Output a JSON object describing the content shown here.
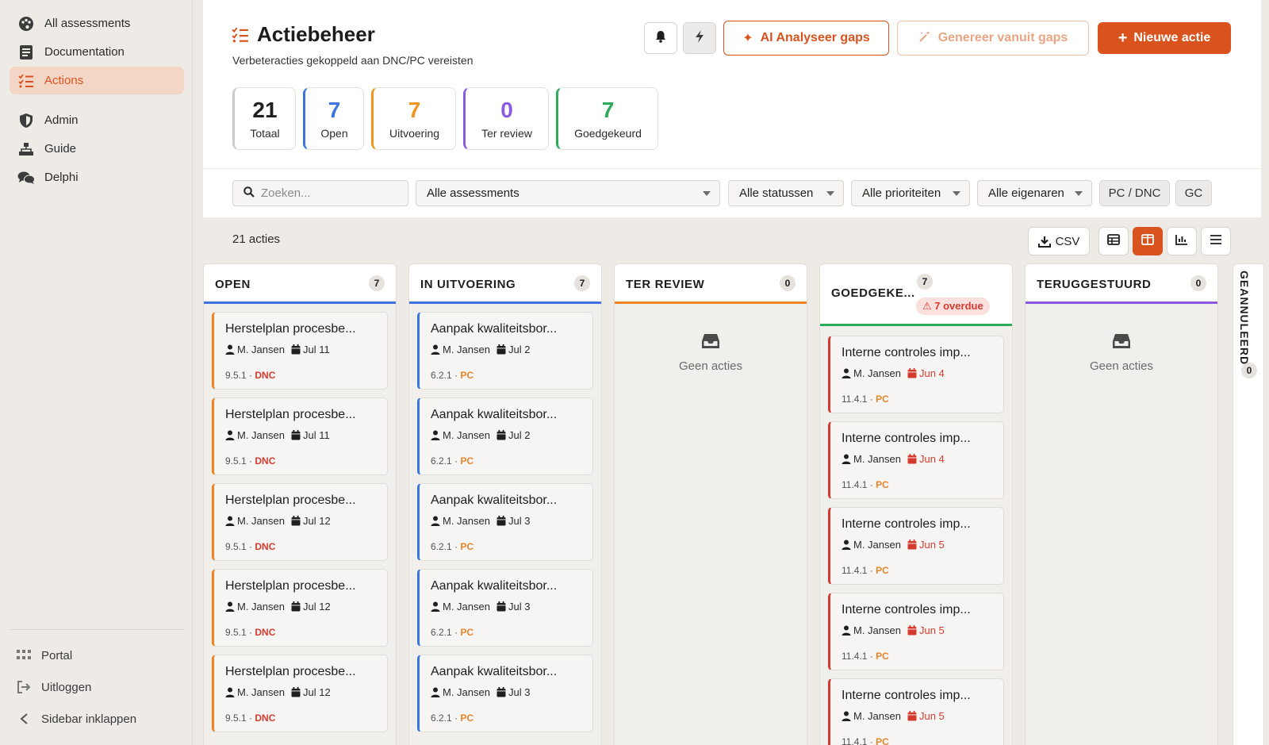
{
  "sidebar": {
    "items": [
      {
        "label": "All assessments",
        "icon": "palette-icon"
      },
      {
        "label": "Documentation",
        "icon": "document-icon"
      },
      {
        "label": "Actions",
        "icon": "list-check-icon"
      },
      {
        "label": "Admin",
        "icon": "shield-icon"
      },
      {
        "label": "Guide",
        "icon": "sitemap-icon"
      },
      {
        "label": "Delphi",
        "icon": "comments-icon"
      }
    ],
    "footer": {
      "portal": "Portal",
      "logout": "Uitloggen",
      "collapse": "Sidebar inklappen"
    }
  },
  "header": {
    "title": "Actiebeheer",
    "subtitle": "Verbeteracties gekoppeld aan DNC/PC vereisten",
    "ai_button": "AI Analyseer gaps",
    "generate_button": "Genereer vanuit gaps",
    "new_button": "Nieuwe actie"
  },
  "stats": [
    {
      "value": "21",
      "label": "Totaal",
      "color": "#1f1f1f"
    },
    {
      "value": "7",
      "label": "Open",
      "color": "#3b73e0"
    },
    {
      "value": "7",
      "label": "Uitvoering",
      "color": "#f0941e"
    },
    {
      "value": "0",
      "label": "Ter review",
      "color": "#8a5ae0"
    },
    {
      "value": "7",
      "label": "Goedgekeurd",
      "color": "#2eaa5a"
    }
  ],
  "filters": {
    "search_placeholder": "Zoeken...",
    "assessments": "Alle assessments",
    "statuses": "Alle statussen",
    "priorities": "Alle prioriteiten",
    "owners": "Alle eigenaren",
    "chip_pc_dnc": "PC / DNC",
    "chip_gc": "GC"
  },
  "toolbar": {
    "count": "21 acties",
    "csv": "CSV"
  },
  "columns": {
    "open": {
      "title": "OPEN",
      "count": "7",
      "color": "#3b73e0",
      "cards": [
        {
          "title": "Herstelplan procesbe...",
          "owner": "M. Jansen",
          "date": "Jul 11",
          "ref": "9.5.1 ·",
          "tag": "DNC"
        },
        {
          "title": "Herstelplan procesbe...",
          "owner": "M. Jansen",
          "date": "Jul 11",
          "ref": "9.5.1 ·",
          "tag": "DNC"
        },
        {
          "title": "Herstelplan procesbe...",
          "owner": "M. Jansen",
          "date": "Jul 12",
          "ref": "9.5.1 ·",
          "tag": "DNC"
        },
        {
          "title": "Herstelplan procesbe...",
          "owner": "M. Jansen",
          "date": "Jul 12",
          "ref": "9.5.1 ·",
          "tag": "DNC"
        },
        {
          "title": "Herstelplan procesbe...",
          "owner": "M. Jansen",
          "date": "Jul 12",
          "ref": "9.5.1 ·",
          "tag": "DNC"
        }
      ]
    },
    "progress": {
      "title": "IN UITVOERING",
      "count": "7",
      "color": "#3b73e0",
      "cards": [
        {
          "title": "Aanpak kwaliteitsbor...",
          "owner": "M. Jansen",
          "date": "Jul 2",
          "ref": "6.2.1 ·",
          "tag": "PC"
        },
        {
          "title": "Aanpak kwaliteitsbor...",
          "owner": "M. Jansen",
          "date": "Jul 2",
          "ref": "6.2.1 ·",
          "tag": "PC"
        },
        {
          "title": "Aanpak kwaliteitsbor...",
          "owner": "M. Jansen",
          "date": "Jul 3",
          "ref": "6.2.1 ·",
          "tag": "PC"
        },
        {
          "title": "Aanpak kwaliteitsbor...",
          "owner": "M. Jansen",
          "date": "Jul 3",
          "ref": "6.2.1 ·",
          "tag": "PC"
        },
        {
          "title": "Aanpak kwaliteitsbor...",
          "owner": "M. Jansen",
          "date": "Jul 3",
          "ref": "6.2.1 ·",
          "tag": "PC"
        }
      ]
    },
    "review": {
      "title": "TER REVIEW",
      "count": "0",
      "color": "#f0842a",
      "empty": "Geen acties"
    },
    "approved": {
      "title": "GOEDGEKE...",
      "count": "7",
      "overdue": "⚠ 7 overdue",
      "color": "#2eaa5a",
      "cards": [
        {
          "title": "Interne controles imp...",
          "owner": "M. Jansen",
          "date": "Jun 4",
          "ref": "11.4.1 ·",
          "tag": "PC"
        },
        {
          "title": "Interne controles imp...",
          "owner": "M. Jansen",
          "date": "Jun 4",
          "ref": "11.4.1 ·",
          "tag": "PC"
        },
        {
          "title": "Interne controles imp...",
          "owner": "M. Jansen",
          "date": "Jun 5",
          "ref": "11.4.1 ·",
          "tag": "PC"
        },
        {
          "title": "Interne controles imp...",
          "owner": "M. Jansen",
          "date": "Jun 5",
          "ref": "11.4.1 ·",
          "tag": "PC"
        },
        {
          "title": "Interne controles imp...",
          "owner": "M. Jansen",
          "date": "Jun 5",
          "ref": "11.4.1 ·",
          "tag": "PC"
        }
      ]
    },
    "returned": {
      "title": "TERUGGESTUURD",
      "count": "0",
      "color": "#8a5ae0",
      "empty": "Geen acties"
    },
    "cancelled": {
      "title": "GEANNULEERD",
      "count": "0"
    }
  },
  "colors": {
    "accent": "#d9531e",
    "dnc": "#d63b2f",
    "pc": "#e8842a",
    "overdue_date": "#d63b2f"
  }
}
